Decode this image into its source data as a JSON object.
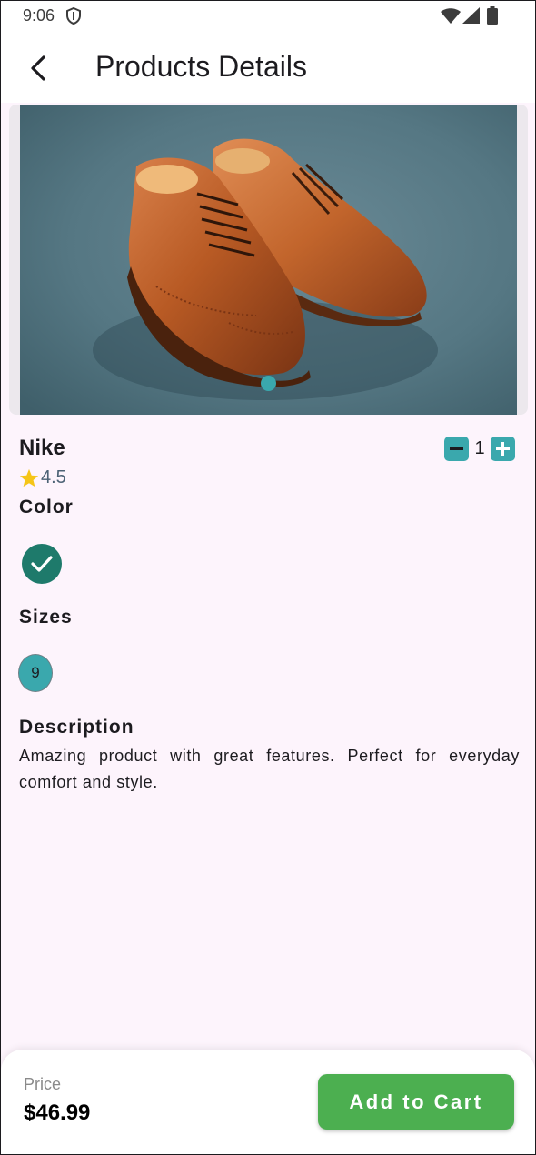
{
  "status_bar": {
    "time": "9:06",
    "icons": [
      "shield-icon",
      "wifi-icon",
      "signal-icon",
      "battery-icon"
    ]
  },
  "app_bar": {
    "back_icon": "chevron-left-icon",
    "title": "Products Details"
  },
  "product": {
    "image_icon": "brown-brogue-shoes-photo",
    "name": "Nike",
    "rating": "4.5",
    "quantity": "1",
    "color_label": "Color",
    "colors": [
      {
        "hex": "#1e7a6b",
        "selected": true
      }
    ],
    "sizes_label": "Sizes",
    "sizes": [
      "9"
    ],
    "description_label": "Description",
    "description": "Amazing product with great features. Perfect for everyday comfort and style."
  },
  "bottom_bar": {
    "price_label": "Price",
    "price": "$46.99",
    "add_to_cart_label": "Add to Cart"
  },
  "colors": {
    "accent": "#3aa8ad",
    "cta": "#4caf50",
    "star": "#f5c518",
    "page_background": "#fdf4fc"
  }
}
